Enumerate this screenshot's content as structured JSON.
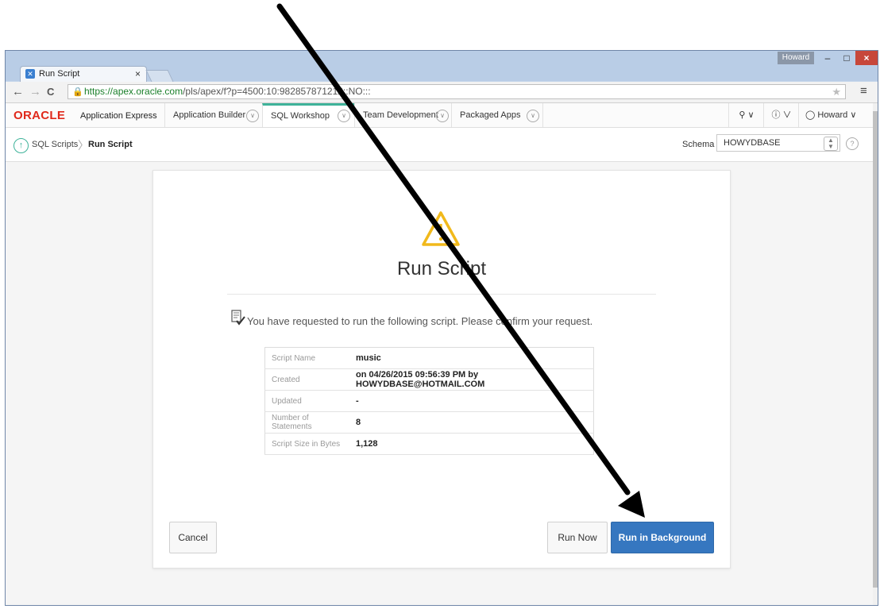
{
  "browser": {
    "tab_title": "Run Script",
    "tab_close": "×",
    "profile_name": "Howard",
    "window_controls": {
      "minimize": "–",
      "maximize": "□",
      "close": "×"
    },
    "nav": {
      "back": "←",
      "forward": "→",
      "reload": "C"
    },
    "url_scheme": "https://",
    "url_host": "apex.oracle.com",
    "url_path": "/pls/apex/f?p=4500:10:982857871212::NO:::",
    "menu_glyph": "≡",
    "star_glyph": "★"
  },
  "apex_nav": {
    "logo_oracle": "ORACLE",
    "logo_product": "Application Express",
    "tabs": [
      {
        "label": "Application Builder"
      },
      {
        "label": "SQL Workshop",
        "active": true
      },
      {
        "label": "Team Development"
      },
      {
        "label": "Packaged Apps"
      }
    ],
    "user_name": "Howard"
  },
  "breadcrumb": {
    "parent": "SQL Scripts",
    "current": "Run Script",
    "separator": "〉"
  },
  "schema": {
    "label": "Schema",
    "value": "HOWYDBASE"
  },
  "dialog": {
    "title": "Run Script",
    "message": "You have requested to run the following script. Please confirm your request.",
    "rows": [
      {
        "key": "Script Name",
        "value": "music"
      },
      {
        "key": "Created",
        "value": "on 04/26/2015 09:56:39 PM by HOWYDBASE@HOTMAIL.COM"
      },
      {
        "key": "Updated",
        "value": "-"
      },
      {
        "key": "Number of Statements",
        "value": "8"
      },
      {
        "key": "Script Size in Bytes",
        "value": "1,128"
      }
    ],
    "buttons": {
      "cancel": "Cancel",
      "run_now": "Run Now",
      "run_background": "Run in Background"
    }
  },
  "colors": {
    "accent": "#3fb39a",
    "primary_button": "#3677c0",
    "oracle_red": "#e0291b",
    "warning": "#f1b91b"
  },
  "annotation": {
    "type": "arrow",
    "color": "#000000",
    "points_to": "run-in-background-button"
  }
}
